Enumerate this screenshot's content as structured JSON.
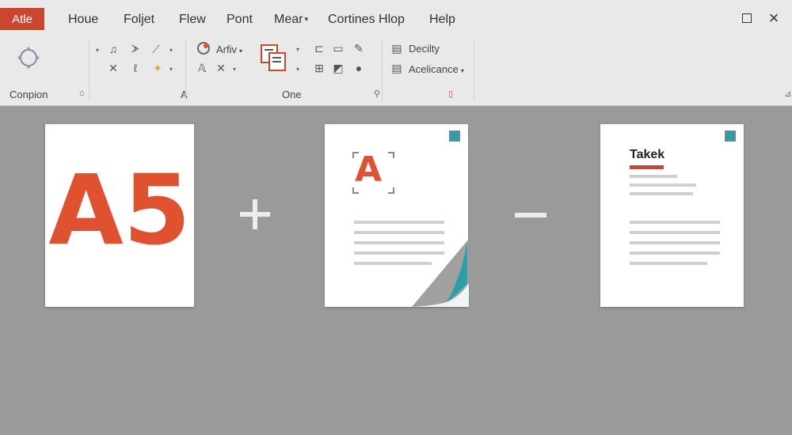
{
  "menubar": {
    "file_tab": "Atle",
    "items": [
      {
        "label": "Houe"
      },
      {
        "label": "Foljet"
      },
      {
        "label": "Flew"
      },
      {
        "label": "Pont"
      },
      {
        "label": "Mear"
      },
      {
        "label": "Cortines Hlop"
      },
      {
        "label": "Help"
      }
    ]
  },
  "ribbon": {
    "text_items": {
      "font_name": "Arfiv",
      "density": "Decilty",
      "acceleration": "Acelicance"
    },
    "group_labels": {
      "g1": "Conpion",
      "g2": "A",
      "g3": "One"
    }
  },
  "content": {
    "card1_text": "A5",
    "card2_letter": "A",
    "card3_title": "Takek",
    "operator_plus": "+",
    "operator_minus": "−"
  },
  "colors": {
    "accent_red": "#c9472f",
    "letter_orange": "#e0512f",
    "teal": "#2a9fa8",
    "canvas_bg": "#9a9a9a"
  }
}
